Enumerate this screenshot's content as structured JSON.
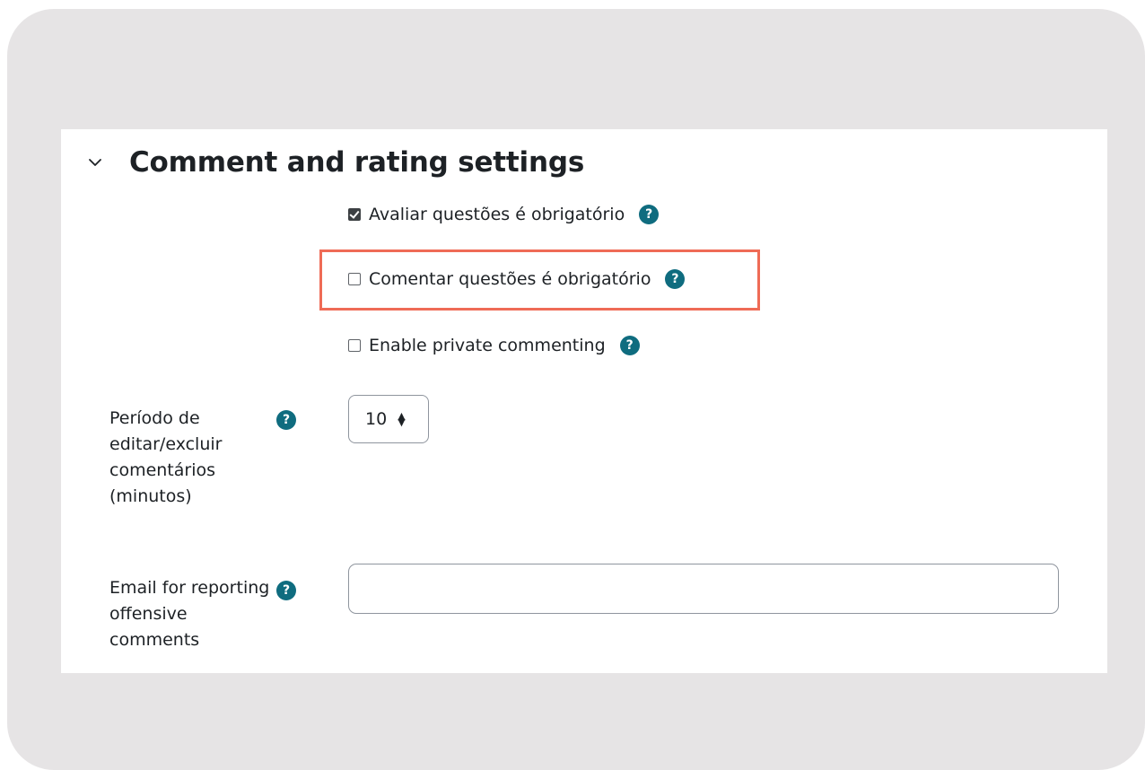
{
  "section": {
    "title": "Comment and rating settings",
    "expand_icon": "chevron-down-icon"
  },
  "checkboxes": [
    {
      "label": "Avaliar questões é obrigatório",
      "checked": true,
      "help_icon": "help-icon"
    },
    {
      "label": "Comentar questões é obrigatório",
      "checked": false,
      "help_icon": "help-icon",
      "highlighted": true
    },
    {
      "label": "Enable private commenting",
      "checked": false,
      "help_icon": "help-icon"
    }
  ],
  "edit_period": {
    "label_lines": [
      "Período de",
      "editar/excluir",
      "comentários",
      "(minutos)"
    ],
    "value": "10",
    "help_icon": "help-icon"
  },
  "report_email": {
    "label_lines": [
      "Email for reporting",
      "offensive",
      "comments"
    ],
    "value": "",
    "placeholder": "",
    "help_icon": "help-icon"
  },
  "help_glyph": "?",
  "colors": {
    "help_icon": "#0f6c7f",
    "highlight_border": "#ef6b56",
    "frame_background": "#e6e4e5"
  }
}
